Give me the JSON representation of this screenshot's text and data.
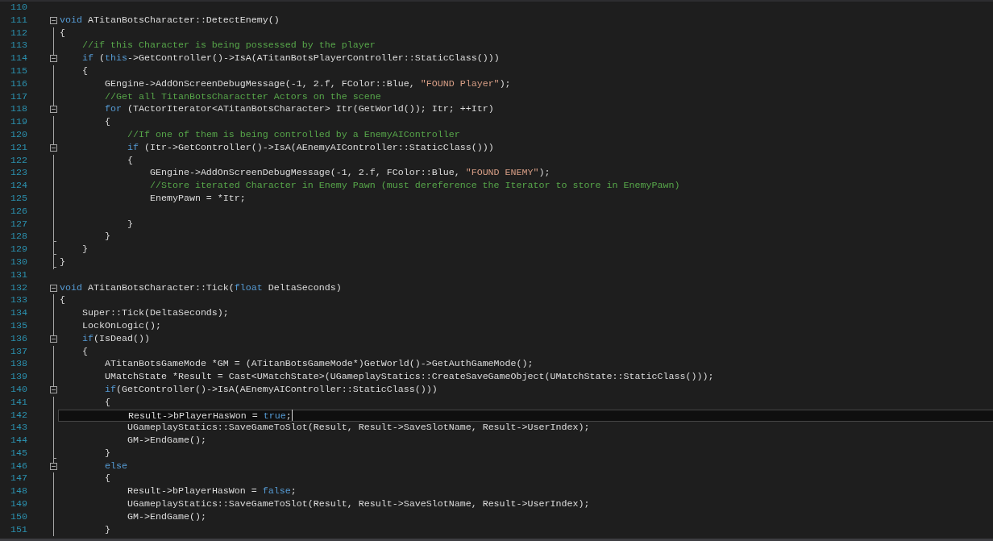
{
  "editor": {
    "lines": [
      {
        "number": "110",
        "kind": "outer"
      },
      {
        "number": "111",
        "kind": "start",
        "tokens": [
          {
            "kind": "keyword",
            "text": "void"
          },
          {
            "kind": "plain",
            "text": " ATitanBotsCharacter::DetectEnemy()"
          }
        ]
      },
      {
        "number": "112",
        "kind": "body",
        "tokens": [
          {
            "kind": "plain",
            "text": "{"
          }
        ]
      },
      {
        "number": "113",
        "kind": "body",
        "tokens": [
          {
            "kind": "comment",
            "text": "    //if this Character is being possessed by the player"
          }
        ]
      },
      {
        "number": "114",
        "kind": "start",
        "tokens": [
          {
            "kind": "keyword",
            "text": "    if"
          },
          {
            "kind": "plain",
            "text": " ("
          },
          {
            "kind": "keyword",
            "text": "this"
          },
          {
            "kind": "plain",
            "text": "->GetController()->IsA(ATitanBotsPlayerController::StaticClass()))"
          }
        ]
      },
      {
        "number": "115",
        "kind": "body",
        "tokens": [
          {
            "kind": "plain",
            "text": "    {"
          }
        ]
      },
      {
        "number": "116",
        "kind": "body",
        "tokens": [
          {
            "kind": "plain",
            "text": "        GEngine->AddOnScreenDebugMessage(-1, 2.f, FColor::Blue, "
          },
          {
            "kind": "string",
            "text": "\"FOUND Player\""
          },
          {
            "kind": "plain",
            "text": ");"
          }
        ]
      },
      {
        "number": "117",
        "kind": "body",
        "tokens": [
          {
            "kind": "comment",
            "text": "        //Get all TitanBotsCharactter Actors on the scene"
          }
        ]
      },
      {
        "number": "118",
        "kind": "start",
        "tokens": [
          {
            "kind": "keyword",
            "text": "        for"
          },
          {
            "kind": "plain",
            "text": " (TActorIterator<ATitanBotsCharacter> Itr(GetWorld()); Itr; ++Itr)"
          }
        ]
      },
      {
        "number": "119",
        "kind": "body",
        "tokens": [
          {
            "kind": "plain",
            "text": "        {"
          }
        ]
      },
      {
        "number": "120",
        "kind": "body",
        "tokens": [
          {
            "kind": "comment",
            "text": "            //If one of them is being controlled by a EnemyAIController"
          }
        ]
      },
      {
        "number": "121",
        "kind": "start",
        "tokens": [
          {
            "kind": "keyword",
            "text": "            if"
          },
          {
            "kind": "plain",
            "text": " (Itr->GetController()->IsA(AEnemyAIController::StaticClass()))"
          }
        ]
      },
      {
        "number": "122",
        "kind": "body",
        "tokens": [
          {
            "kind": "plain",
            "text": "            {"
          }
        ]
      },
      {
        "number": "123",
        "kind": "body",
        "tokens": [
          {
            "kind": "plain",
            "text": "                GEngine->AddOnScreenDebugMessage(-1, 2.f, FColor::Blue, "
          },
          {
            "kind": "string",
            "text": "\"FOUND ENEMY\""
          },
          {
            "kind": "plain",
            "text": ");"
          }
        ]
      },
      {
        "number": "124",
        "kind": "body",
        "tokens": [
          {
            "kind": "comment",
            "text": "                //Store iterated Character in Enemy Pawn (must dereference the Iterator to store in EnemyPawn)"
          }
        ]
      },
      {
        "number": "125",
        "kind": "body",
        "tokens": [
          {
            "kind": "plain",
            "text": "                EnemyPawn = *Itr;"
          }
        ]
      },
      {
        "number": "126",
        "kind": "body"
      },
      {
        "number": "127",
        "kind": "body",
        "tokens": [
          {
            "kind": "plain",
            "text": "            }"
          }
        ]
      },
      {
        "number": "128",
        "kind": "end",
        "tokens": [
          {
            "kind": "plain",
            "text": "        }"
          }
        ]
      },
      {
        "number": "129",
        "kind": "end",
        "tokens": [
          {
            "kind": "plain",
            "text": "    }"
          }
        ]
      },
      {
        "number": "130",
        "kind": "end",
        "tokens": [
          {
            "kind": "plain",
            "text": "}"
          }
        ]
      },
      {
        "number": "131",
        "kind": "outer"
      },
      {
        "number": "132",
        "kind": "start",
        "tokens": [
          {
            "kind": "keyword",
            "text": "void"
          },
          {
            "kind": "plain",
            "text": " ATitanBotsCharacter::Tick("
          },
          {
            "kind": "keyword",
            "text": "float"
          },
          {
            "kind": "plain",
            "text": " DeltaSeconds)"
          }
        ]
      },
      {
        "number": "133",
        "kind": "body",
        "tokens": [
          {
            "kind": "plain",
            "text": "{"
          }
        ]
      },
      {
        "number": "134",
        "kind": "body",
        "tokens": [
          {
            "kind": "plain",
            "text": "    Super::Tick(DeltaSeconds);"
          }
        ]
      },
      {
        "number": "135",
        "kind": "body",
        "tokens": [
          {
            "kind": "plain",
            "text": "    LockOnLogic();"
          }
        ]
      },
      {
        "number": "136",
        "kind": "start",
        "tokens": [
          {
            "kind": "keyword",
            "text": "    if"
          },
          {
            "kind": "plain",
            "text": "(IsDead())"
          }
        ]
      },
      {
        "number": "137",
        "kind": "body",
        "tokens": [
          {
            "kind": "plain",
            "text": "    {"
          }
        ]
      },
      {
        "number": "138",
        "kind": "body",
        "tokens": [
          {
            "kind": "plain",
            "text": "        ATitanBotsGameMode *GM = (ATitanBotsGameMode*)GetWorld()->GetAuthGameMode();"
          }
        ]
      },
      {
        "number": "139",
        "kind": "body",
        "tokens": [
          {
            "kind": "plain",
            "text": "        UMatchState *Result = Cast<UMatchState>(UGameplayStatics::CreateSaveGameObject(UMatchState::StaticClass()));"
          }
        ]
      },
      {
        "number": "140",
        "kind": "start",
        "tokens": [
          {
            "kind": "keyword",
            "text": "        if"
          },
          {
            "kind": "plain",
            "text": "(GetController()->IsA(AEnemyAIController::StaticClass()))"
          }
        ]
      },
      {
        "number": "141",
        "kind": "body",
        "tokens": [
          {
            "kind": "plain",
            "text": "        {"
          }
        ]
      },
      {
        "number": "142",
        "kind": "body",
        "current": true,
        "tokens": [
          {
            "kind": "plain",
            "text": "            Result->bPlayerHasWon = "
          },
          {
            "kind": "keyword",
            "text": "true"
          },
          {
            "kind": "plain",
            "text": ";"
          }
        ]
      },
      {
        "number": "143",
        "kind": "body",
        "tokens": [
          {
            "kind": "plain",
            "text": "            UGameplayStatics::SaveGameToSlot(Result, Result->SaveSlotName, Result->UserIndex);"
          }
        ]
      },
      {
        "number": "144",
        "kind": "body",
        "tokens": [
          {
            "kind": "plain",
            "text": "            GM->EndGame();"
          }
        ]
      },
      {
        "number": "145",
        "kind": "end",
        "tokens": [
          {
            "kind": "plain",
            "text": "        }"
          }
        ]
      },
      {
        "number": "146",
        "kind": "start",
        "tokens": [
          {
            "kind": "keyword",
            "text": "        else"
          }
        ]
      },
      {
        "number": "147",
        "kind": "body",
        "tokens": [
          {
            "kind": "plain",
            "text": "        {"
          }
        ]
      },
      {
        "number": "148",
        "kind": "body",
        "tokens": [
          {
            "kind": "plain",
            "text": "            Result->bPlayerHasWon = "
          },
          {
            "kind": "keyword",
            "text": "false"
          },
          {
            "kind": "plain",
            "text": ";"
          }
        ]
      },
      {
        "number": "149",
        "kind": "body",
        "tokens": [
          {
            "kind": "plain",
            "text": "            UGameplayStatics::SaveGameToSlot(Result, Result->SaveSlotName, Result->UserIndex);"
          }
        ]
      },
      {
        "number": "150",
        "kind": "body",
        "tokens": [
          {
            "kind": "plain",
            "text": "            GM->EndGame();"
          }
        ]
      },
      {
        "number": "151",
        "kind": "body",
        "tokens": [
          {
            "kind": "plain",
            "text": "        }"
          }
        ]
      }
    ]
  }
}
